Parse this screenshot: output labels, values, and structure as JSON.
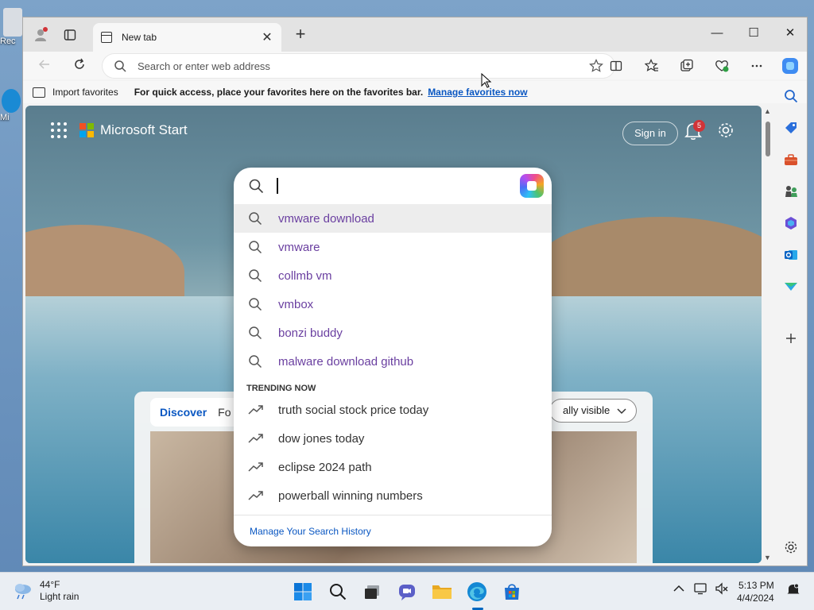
{
  "desktop": {
    "icons": [
      {
        "label": "Rec"
      },
      {
        "label": "Mi"
      }
    ]
  },
  "browser": {
    "tab": {
      "title": "New tab",
      "close_glyph": "✕"
    },
    "new_tab_glyph": "+",
    "window_controls": {
      "minimize": "—",
      "maximize": "☐",
      "close": "✕"
    },
    "address_bar": {
      "placeholder": "Search or enter web address",
      "value": ""
    },
    "favorites_bar": {
      "import_label": "Import favorites",
      "hint": "For quick access, place your favorites here on the favorites bar.",
      "manage_link": "Manage favorites now"
    }
  },
  "start_page": {
    "brand": "Microsoft Start",
    "sign_in": "Sign in",
    "notification_count": "5",
    "feed": {
      "tabs": [
        "Discover",
        "Fo"
      ],
      "visibility_button": "ally visible"
    }
  },
  "search_popup": {
    "query": "",
    "suggestions": [
      "vmware download",
      "vmware",
      "collmb vm",
      "vmbox",
      "bonzi buddy",
      "malware download github"
    ],
    "trending_header": "TRENDING NOW",
    "trending": [
      "truth social stock price today",
      "dow jones today",
      "eclipse 2024 path",
      "powerball winning numbers"
    ],
    "manage_history": "Manage Your Search History"
  },
  "taskbar": {
    "weather": {
      "temp": "44°F",
      "condition": "Light rain"
    },
    "clock": {
      "time": "5:13 PM",
      "date": "4/4/2024"
    }
  },
  "colors": {
    "accent": "#0067c0",
    "link": "#0a57c2",
    "suggestion_text": "#6a3fa0",
    "notification_badge": "#d13438"
  }
}
